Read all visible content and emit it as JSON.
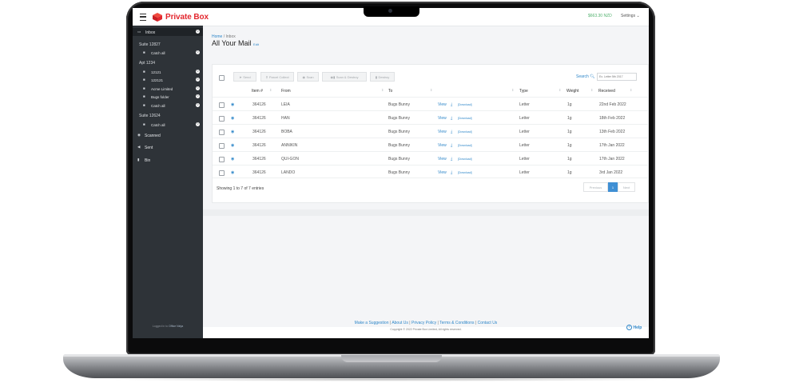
{
  "brand": {
    "name": "Private Box",
    "accent": "#e3282f"
  },
  "topbar": {
    "balance": "$663.30 NZD",
    "settings_label": "Settings"
  },
  "sidebar": {
    "inbox": {
      "label": "Inbox",
      "count": "0"
    },
    "groups": [
      {
        "label": "Suite 12827",
        "items": [
          {
            "label": "Catch all",
            "count": "0"
          }
        ]
      },
      {
        "label": "Apt 1234",
        "items": [
          {
            "label": "12121",
            "count": "0"
          },
          {
            "label": "122121",
            "count": "0"
          },
          {
            "label": "Acme Limited",
            "count": "0"
          },
          {
            "label": "Bugs folder",
            "count": "0"
          },
          {
            "label": "Catch all",
            "count": "0"
          }
        ]
      },
      {
        "label": "Suite 12624",
        "items": [
          {
            "label": "Catch all",
            "count": "0"
          }
        ]
      }
    ],
    "scanned": "Scanned",
    "sent": "Sent",
    "bin": "Bin",
    "footer_prefix": "Logged in to",
    "footer_link": "Office Ninja"
  },
  "breadcrumb": {
    "home": "Home",
    "separator": "/",
    "current": "Inbox"
  },
  "page": {
    "title": "All Your Mail",
    "edit": "Edit"
  },
  "toolbar": {
    "send": "Send",
    "parcel_collect": "Parcel Collect",
    "scan": "Scan",
    "scan_destroy": "Scan & Destroy",
    "destroy": "Destroy",
    "search_label": "Search",
    "search_placeholder": "Ex. Letter 5th 2017"
  },
  "table": {
    "headers": {
      "item": "Item #",
      "from": "From",
      "to": "To",
      "type": "Type",
      "weight": "Weight",
      "received": "Received"
    },
    "rows": [
      {
        "item": "364126",
        "from": "LEIA",
        "to": "Bugs Bunny",
        "view": "View",
        "download": "[Download]",
        "type": "Letter",
        "weight": "1g",
        "received": "22nd Feb 2022"
      },
      {
        "item": "364126",
        "from": "HAN",
        "to": "Bugs Bunny",
        "view": "View",
        "download": "[Download]",
        "type": "Letter",
        "weight": "1g",
        "received": "18th Feb 2022"
      },
      {
        "item": "364126",
        "from": "BOBA",
        "to": "Bugs Bunny",
        "view": "View",
        "download": "[Download]",
        "type": "Letter",
        "weight": "1g",
        "received": "13th Feb 2022"
      },
      {
        "item": "364126",
        "from": "ANNIKIN",
        "to": "Bugs Bunny",
        "view": "View",
        "download": "[Download]",
        "type": "Letter",
        "weight": "1g",
        "received": "17th Jan 2022"
      },
      {
        "item": "364126",
        "from": "QUI-GON",
        "to": "Bugs Bunny",
        "view": "View",
        "download": "[Download]",
        "type": "Letter",
        "weight": "1g",
        "received": "17th Jan 2022"
      },
      {
        "item": "364126",
        "from": "LANDO",
        "to": "Bugs Bunny",
        "view": "View",
        "download": "[Download]",
        "type": "Letter",
        "weight": "1g",
        "received": "3rd Jan 2022"
      }
    ],
    "showing": "Showing 1 to 7 of 7 entries"
  },
  "pagination": {
    "previous": "Previous",
    "page": "1",
    "next": "Next"
  },
  "footer": {
    "links": [
      "Make a Suggestion",
      "About Us",
      "Privacy Policy",
      "Terms & Conditions",
      "Contact Us"
    ],
    "separator": "|",
    "copyright": "Copyright © 2022 Private Box Limited, All rights reserved.",
    "help": "Help"
  },
  "colors": {
    "link": "#2f87c9",
    "balance": "#4fb06c",
    "sidebar": "#2e3338"
  }
}
